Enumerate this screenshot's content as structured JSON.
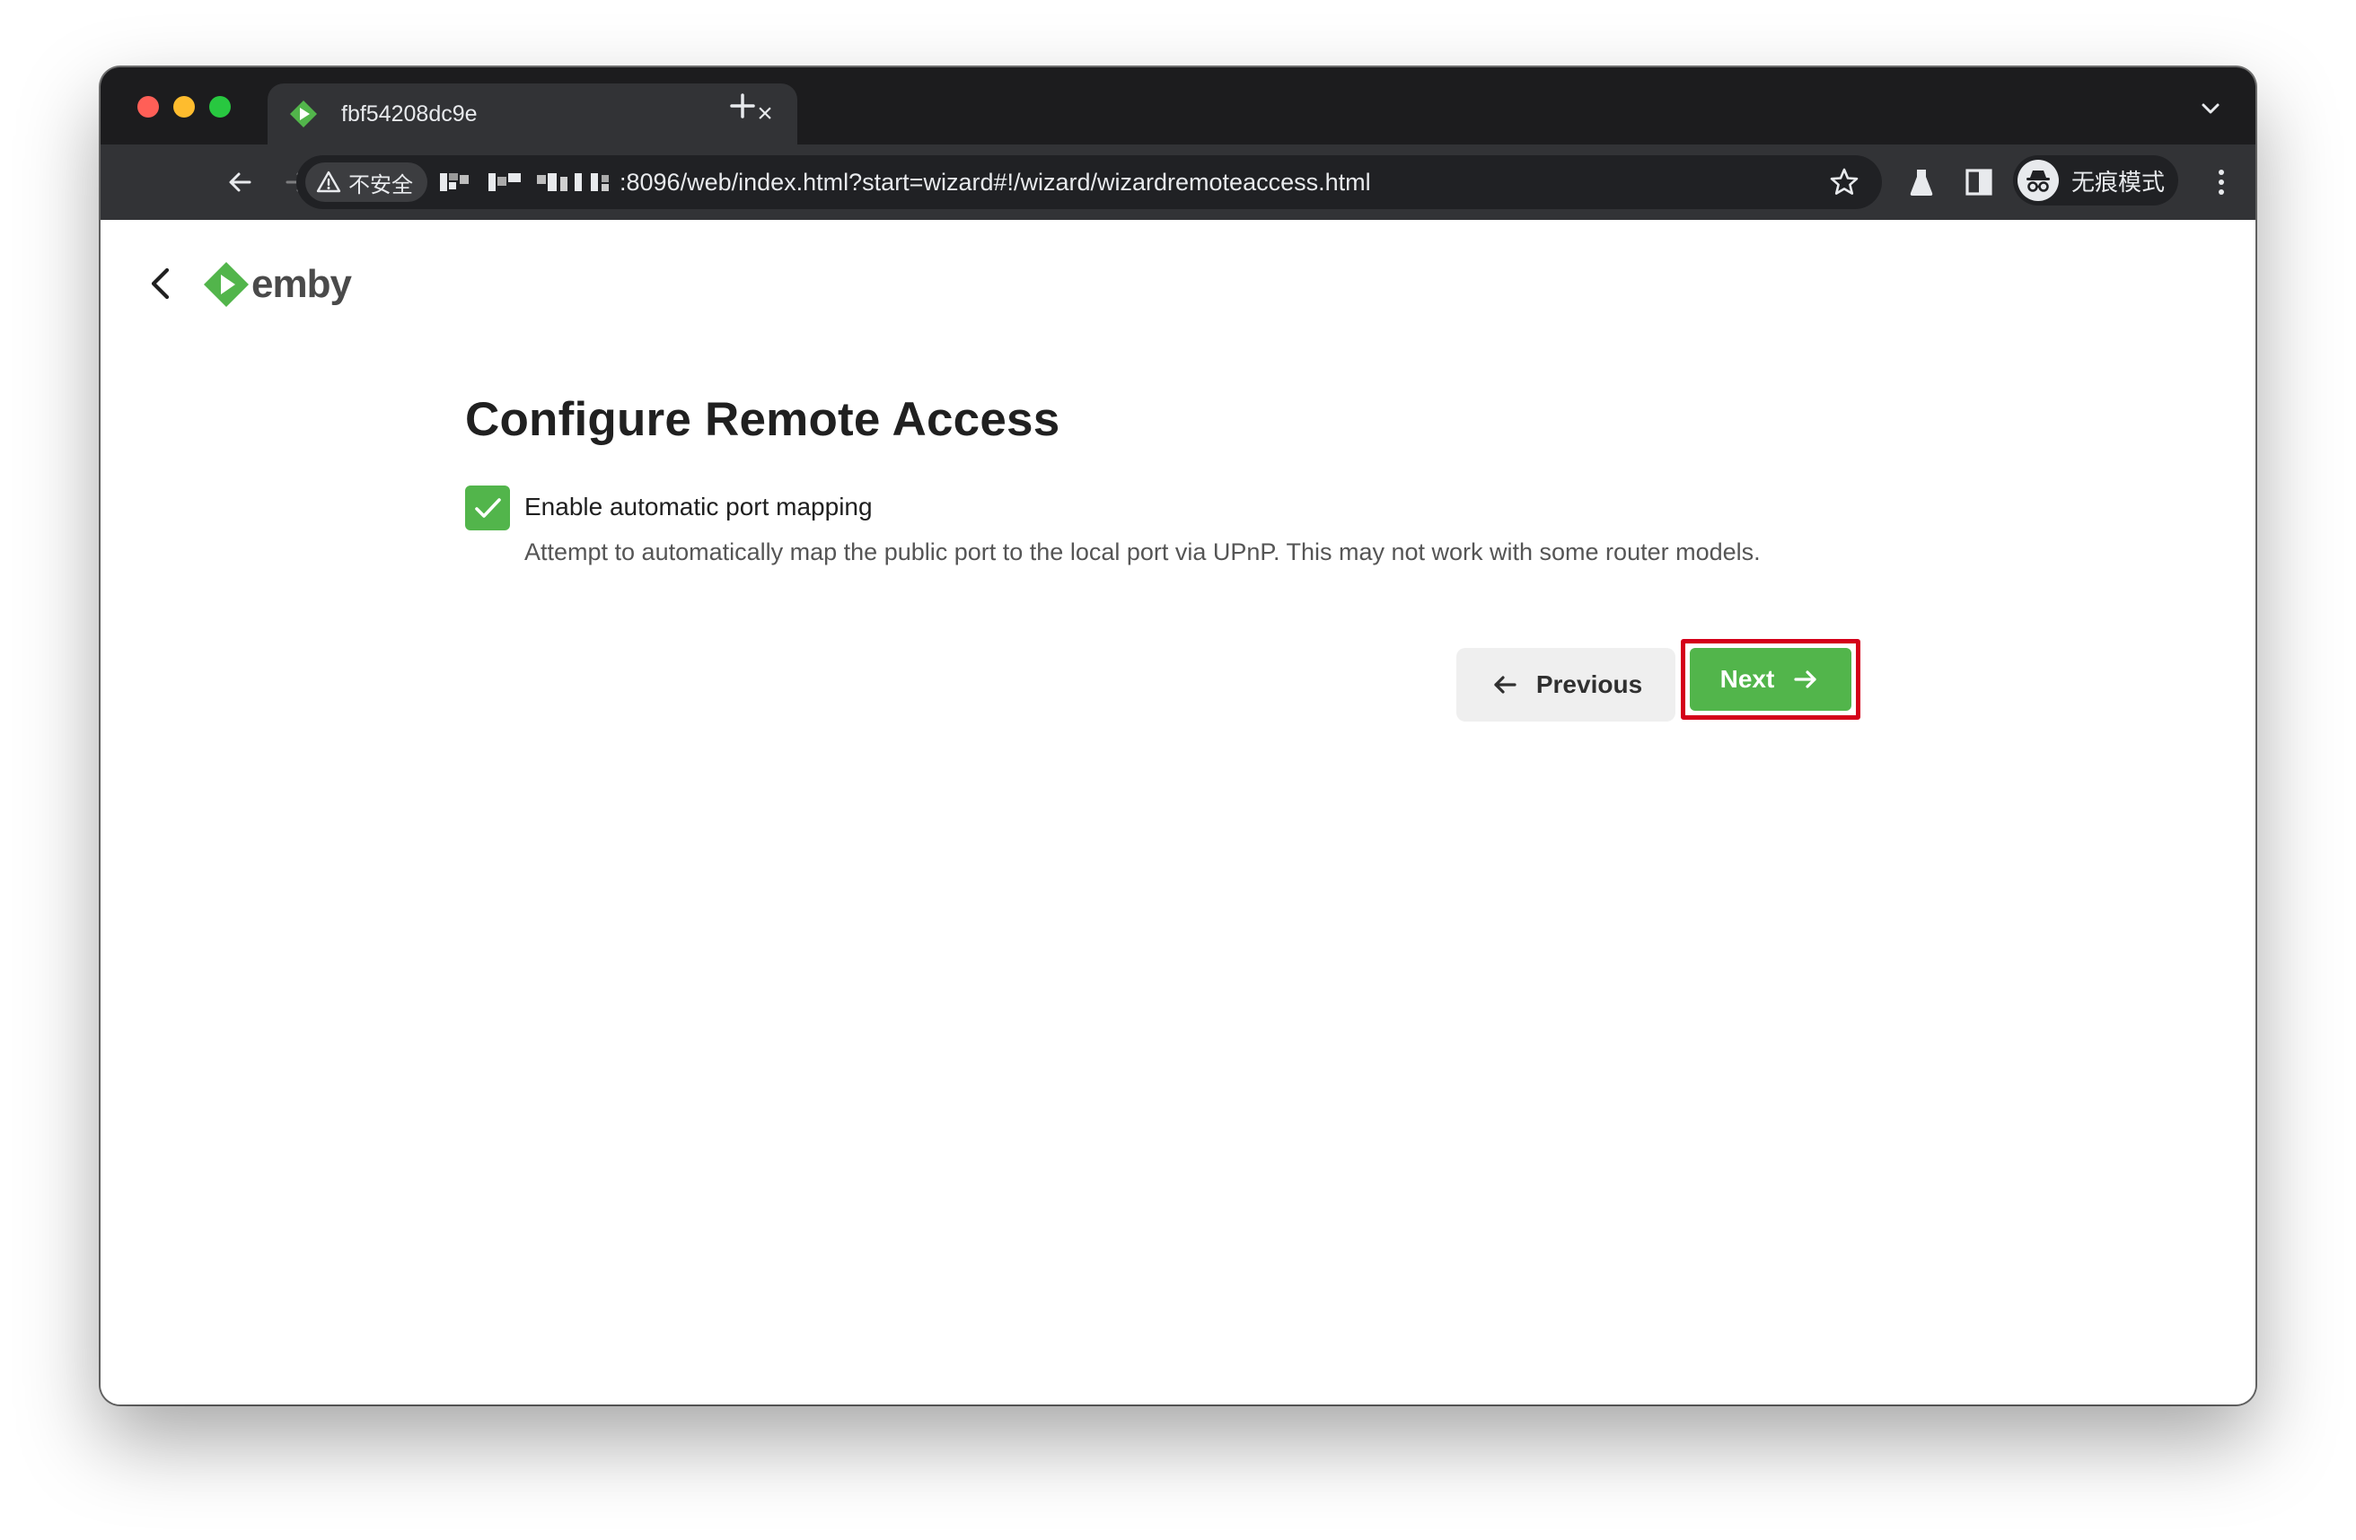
{
  "browser": {
    "tab_title": "fbf54208dc9e",
    "close_glyph": "×",
    "security_label": "不安全",
    "url": ":8096/web/index.html?start=wizard#!/wizard/wizardremoteaccess.html",
    "profile_label": "无痕模式",
    "icons": [
      "back-icon",
      "forward-icon",
      "reload-icon",
      "warning-icon",
      "star-icon",
      "labs-icon",
      "side-panel-icon",
      "incognito-icon",
      "more-icon",
      "new-tab-icon",
      "tab-search-icon"
    ]
  },
  "app": {
    "logo_text": "emby",
    "brand_color": "#52b54b"
  },
  "wizard": {
    "title": "Configure Remote Access",
    "port_mapping": {
      "checked": true,
      "label": "Enable automatic port mapping",
      "help": "Attempt to automatically map the public port to the local port via UPnP. This may not work with some router models."
    },
    "buttons": {
      "previous": "Previous",
      "next": "Next"
    },
    "highlight_color": "#d4001a"
  }
}
